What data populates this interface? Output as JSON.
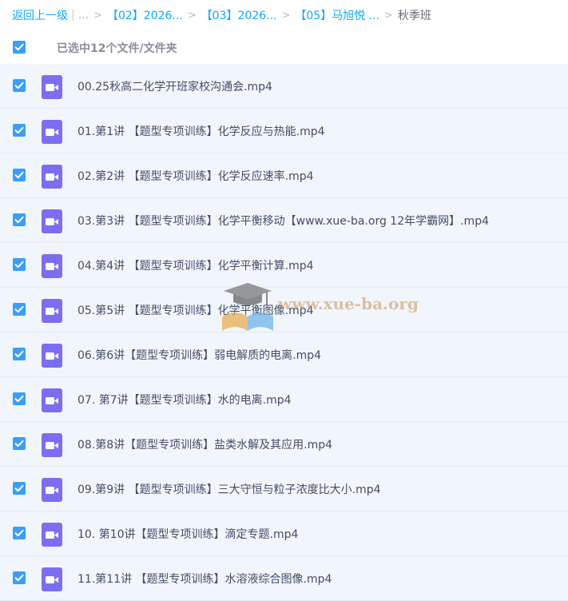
{
  "breadcrumb": {
    "back": "返回上一级",
    "ellipsis": "...",
    "crumbs": [
      "【02】2026...",
      "【03】2026...",
      "【05】马旭悦 ..."
    ],
    "current": "秋季班"
  },
  "selection": {
    "text": "已选中12个文件/文件夹",
    "checked": true
  },
  "files": [
    {
      "name": "00.25秋高二化学开班家校沟通会.mp4",
      "checked": true
    },
    {
      "name": "01.第1讲 【题型专项训练】化学反应与热能.mp4",
      "checked": true
    },
    {
      "name": "02.第2讲 【题型专项训练】化学反应速率.mp4",
      "checked": true
    },
    {
      "name": "03.第3讲 【题型专项训练】化学平衡移动【www.xue-ba.org 12年学霸网】.mp4",
      "checked": true
    },
    {
      "name": "04.第4讲 【题型专项训练】化学平衡计算.mp4",
      "checked": true
    },
    {
      "name": "05.第5讲 【题型专项训练】化学平衡图像.mp4",
      "checked": true
    },
    {
      "name": "06.第6讲【题型专项训练】弱电解质的电离.mp4",
      "checked": true
    },
    {
      "name": "07. 第7讲【题型专项训练】水的电离.mp4",
      "checked": true
    },
    {
      "name": "08.第8讲【题型专项训练】盐类水解及其应用.mp4",
      "checked": true
    },
    {
      "name": "09.第9讲 【题型专项训练】三大守恒与粒子浓度比大小.mp4",
      "checked": true
    },
    {
      "name": "10. 第10讲【题型专项训练】滴定专题.mp4",
      "checked": true
    },
    {
      "name": "11.第11讲 【题型专项训练】水溶液综合图像.mp4",
      "checked": true
    }
  ],
  "watermark": {
    "text": "www.xue-ba.org"
  },
  "colors": {
    "accent": "#09aaff",
    "checkbox": "#3b9ef8",
    "video_icon": "#7a6ff2",
    "row_bg": "#f1f6fd"
  },
  "icons": {
    "checkbox": "checkmark",
    "file": "video-camera-icon"
  }
}
